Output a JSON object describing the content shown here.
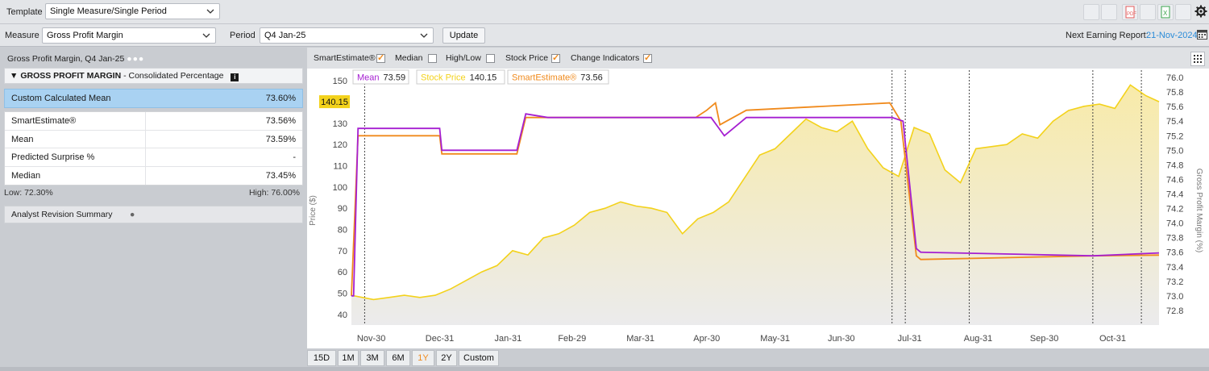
{
  "toolbar": {
    "template_label": "Template",
    "template_value": "Single Measure/Single Period",
    "measure_label": "Measure",
    "measure_value": "Gross Profit Margin",
    "period_label": "Period",
    "period_value": "Q4 Jan-25",
    "update_label": "Update",
    "next_earning_label": "Next Earning Report:",
    "next_earning_date": "21-Nov-2024",
    "icons": [
      "print-icon",
      "pdf-icon",
      "excel-icon",
      "settings-icon",
      "calendar-icon"
    ]
  },
  "left_panel": {
    "header": "Gross Profit Margin, Q4 Jan-25",
    "section_title": "GROSS PROFIT MARGIN",
    "section_subtitle": "- Consolidated Percentage",
    "highlight": {
      "label": "Custom Calculated Mean",
      "value": "73.60%"
    },
    "rows": [
      {
        "label": "SmartEstimate®",
        "value": "73.56%"
      },
      {
        "label": "Mean",
        "value": "73.59%"
      },
      {
        "label": "Predicted Surprise %",
        "value": "-"
      },
      {
        "label": "Median",
        "value": "73.45%"
      }
    ],
    "low": "Low: 72.30%",
    "high": "High: 76.00%",
    "analyst_revision": "Analyst Revision Summary"
  },
  "chart_options": [
    {
      "label": "SmartEstimate®",
      "checked": true
    },
    {
      "label": "Median",
      "checked": false
    },
    {
      "label": "High/Low",
      "checked": false
    },
    {
      "label": "Stock Price",
      "checked": true
    },
    {
      "label": "Change Indicators",
      "checked": true
    }
  ],
  "legend": {
    "mean_label": "Mean",
    "mean_value": "73.59",
    "stock_label": "Stock Price",
    "stock_value": "140.15",
    "smart_label": "SmartEstimate®",
    "smart_value": "73.56"
  },
  "price_tag": "140.15",
  "range_buttons": [
    {
      "label": "15D",
      "active": false
    },
    {
      "label": "1M",
      "active": false
    },
    {
      "label": "3M",
      "active": false
    },
    {
      "label": "6M",
      "active": false
    },
    {
      "label": "1Y",
      "active": true
    },
    {
      "label": "2Y",
      "active": false
    },
    {
      "label": "Custom",
      "active": false
    }
  ],
  "colors": {
    "mean": "#a51fd1",
    "smart": "#f08a1c",
    "stock": "#f3d21b",
    "accent": "#2a8bd8"
  },
  "chart_data": {
    "type": "line",
    "ylabel": "Price ($)",
    "y2label": "Gross Profit Margin (%)",
    "ylim": [
      35,
      155
    ],
    "y2lim": [
      72.6,
      76.1
    ],
    "y_ticks": [
      40,
      50,
      60,
      70,
      80,
      90,
      100,
      110,
      120,
      130,
      140,
      150
    ],
    "y2_ticks": [
      72.8,
      73.0,
      73.2,
      73.4,
      73.6,
      73.8,
      74.0,
      74.2,
      74.4,
      74.6,
      74.8,
      75.0,
      75.2,
      75.4,
      75.6,
      75.8,
      76.0
    ],
    "x_ticks": [
      "Nov-30",
      "Dec-31",
      "Jan-31",
      "Feb-29",
      "Mar-31",
      "Apr-30",
      "May-31",
      "Jun-30",
      "Jul-31",
      "Aug-31",
      "Sep-30",
      "Oct-31"
    ],
    "xlim": [
      "2023-11-21",
      "2024-11-21"
    ],
    "change_markers": [
      "2023-11-27",
      "2024-07-23",
      "2024-07-29",
      "2024-08-27",
      "2024-10-22",
      "2024-11-13"
    ],
    "series": [
      {
        "name": "Stock Price",
        "axis": "left",
        "points": [
          [
            "2023-11-21",
            49
          ],
          [
            "2023-11-26",
            48
          ],
          [
            "2023-12-01",
            47
          ],
          [
            "2023-12-08",
            48
          ],
          [
            "2023-12-15",
            49
          ],
          [
            "2023-12-22",
            48
          ],
          [
            "2023-12-29",
            49
          ],
          [
            "2024-01-05",
            52
          ],
          [
            "2024-01-12",
            56
          ],
          [
            "2024-01-19",
            60
          ],
          [
            "2024-01-26",
            63
          ],
          [
            "2024-02-02",
            70
          ],
          [
            "2024-02-09",
            68
          ],
          [
            "2024-02-16",
            76
          ],
          [
            "2024-02-23",
            78
          ],
          [
            "2024-03-01",
            82
          ],
          [
            "2024-03-08",
            88
          ],
          [
            "2024-03-15",
            90
          ],
          [
            "2024-03-22",
            93
          ],
          [
            "2024-03-29",
            91
          ],
          [
            "2024-04-05",
            90
          ],
          [
            "2024-04-12",
            88
          ],
          [
            "2024-04-19",
            78
          ],
          [
            "2024-04-26",
            85
          ],
          [
            "2024-05-03",
            88
          ],
          [
            "2024-05-10",
            93
          ],
          [
            "2024-05-17",
            104
          ],
          [
            "2024-05-24",
            115
          ],
          [
            "2024-05-31",
            118
          ],
          [
            "2024-06-07",
            125
          ],
          [
            "2024-06-14",
            132
          ],
          [
            "2024-06-21",
            128
          ],
          [
            "2024-06-28",
            126
          ],
          [
            "2024-07-05",
            131
          ],
          [
            "2024-07-12",
            118
          ],
          [
            "2024-07-19",
            109
          ],
          [
            "2024-07-26",
            105
          ],
          [
            "2024-08-02",
            128
          ],
          [
            "2024-08-09",
            125
          ],
          [
            "2024-08-16",
            108
          ],
          [
            "2024-08-23",
            102
          ],
          [
            "2024-08-30",
            118
          ],
          [
            "2024-09-06",
            119
          ],
          [
            "2024-09-13",
            120
          ],
          [
            "2024-09-20",
            125
          ],
          [
            "2024-09-27",
            123
          ],
          [
            "2024-10-04",
            131
          ],
          [
            "2024-10-11",
            136
          ],
          [
            "2024-10-18",
            138
          ],
          [
            "2024-10-25",
            139
          ],
          [
            "2024-11-01",
            137
          ],
          [
            "2024-11-08",
            148
          ],
          [
            "2024-11-15",
            143
          ],
          [
            "2024-11-21",
            140.15
          ]
        ]
      },
      {
        "name": "Mean",
        "axis": "right",
        "points": [
          [
            "2023-11-21",
            73.0
          ],
          [
            "2023-11-22",
            73.0
          ],
          [
            "2023-11-24",
            75.3
          ],
          [
            "2023-12-04",
            75.3
          ],
          [
            "2023-12-31",
            75.3
          ],
          [
            "2024-01-01",
            75.0
          ],
          [
            "2024-02-04",
            75.0
          ],
          [
            "2024-02-08",
            75.5
          ],
          [
            "2024-02-18",
            75.45
          ],
          [
            "2024-05-02",
            75.45
          ],
          [
            "2024-05-08",
            75.2
          ],
          [
            "2024-05-18",
            75.45
          ],
          [
            "2024-07-23",
            75.45
          ],
          [
            "2024-07-28",
            75.4
          ],
          [
            "2024-08-03",
            73.65
          ],
          [
            "2024-08-05",
            73.6
          ],
          [
            "2024-10-22",
            73.55
          ],
          [
            "2024-11-21",
            73.59
          ]
        ]
      },
      {
        "name": "SmartEstimate®",
        "axis": "right",
        "points": [
          [
            "2023-11-21",
            73.0
          ],
          [
            "2023-11-24",
            75.2
          ],
          [
            "2023-12-31",
            75.2
          ],
          [
            "2024-01-01",
            74.95
          ],
          [
            "2024-02-04",
            74.95
          ],
          [
            "2024-02-08",
            75.45
          ],
          [
            "2024-02-18",
            75.45
          ],
          [
            "2024-04-25",
            75.45
          ],
          [
            "2024-04-30",
            75.55
          ],
          [
            "2024-05-04",
            75.65
          ],
          [
            "2024-05-06",
            75.35
          ],
          [
            "2024-05-18",
            75.55
          ],
          [
            "2024-07-22",
            75.65
          ],
          [
            "2024-07-27",
            75.4
          ],
          [
            "2024-08-03",
            73.55
          ],
          [
            "2024-08-05",
            73.5
          ],
          [
            "2024-10-22",
            73.55
          ],
          [
            "2024-11-21",
            73.56
          ]
        ]
      }
    ]
  }
}
